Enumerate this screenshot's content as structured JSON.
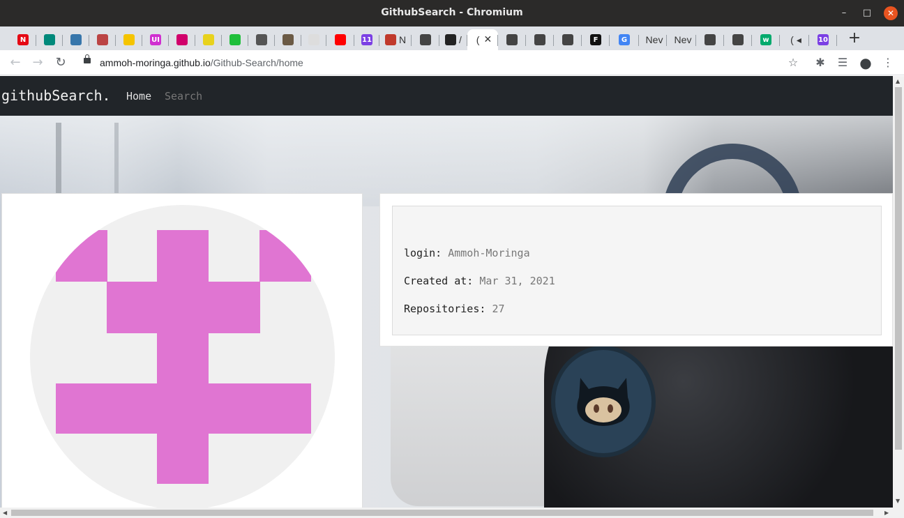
{
  "window": {
    "title": "GithubSearch - Chromium"
  },
  "tabs": [
    {
      "icon": "netflix-icon",
      "color": "#e50914",
      "glyph": "N",
      "label": ""
    },
    {
      "icon": "meet-icon",
      "color": "#00897b",
      "glyph": "",
      "label": ""
    },
    {
      "icon": "python-icon",
      "color": "#3776ab",
      "glyph": "",
      "label": ""
    },
    {
      "icon": "openai-icon",
      "color": "#b44",
      "glyph": "",
      "label": ""
    },
    {
      "icon": "slash-icon",
      "color": "#f5c400",
      "glyph": "",
      "label": ""
    },
    {
      "icon": "ui-icon",
      "color": "#d02fd0",
      "glyph": "UI",
      "label": ""
    },
    {
      "icon": "dribbble-icon",
      "color": "#d1006b",
      "glyph": "",
      "label": ""
    },
    {
      "icon": "yellow-app-icon",
      "color": "#e8d21d",
      "glyph": "",
      "label": ""
    },
    {
      "icon": "green-app-icon",
      "color": "#1fbf3b",
      "glyph": "",
      "label": ""
    },
    {
      "icon": "book-icon",
      "color": "#555",
      "glyph": "",
      "label": ""
    },
    {
      "icon": "photo-icon",
      "color": "#6b5a45",
      "glyph": "",
      "label": ""
    },
    {
      "icon": "box-icon",
      "color": "#ddd",
      "glyph": "",
      "label": ""
    },
    {
      "icon": "youtube-icon",
      "color": "#ff0000",
      "glyph": "",
      "label": ""
    },
    {
      "icon": "calendar-icon",
      "color": "#7b3fe4",
      "glyph": "11",
      "label": ""
    },
    {
      "icon": "record-icon",
      "color": "#c0392b",
      "glyph": "",
      "label": "N"
    },
    {
      "icon": "globe-icon",
      "color": "#444",
      "glyph": "",
      "label": ""
    },
    {
      "icon": "github-icon",
      "color": "#222",
      "glyph": "",
      "label": "/"
    },
    {
      "icon": "active-tab",
      "color": "#fff",
      "glyph": "",
      "label": "("
    },
    {
      "icon": "globe-icon",
      "color": "#444",
      "glyph": "",
      "label": ""
    },
    {
      "icon": "globe-icon",
      "color": "#444",
      "glyph": "",
      "label": ""
    },
    {
      "icon": "globe-icon",
      "color": "#444",
      "glyph": "",
      "label": ""
    },
    {
      "icon": "figma-icon",
      "color": "#111",
      "glyph": "F",
      "label": ""
    },
    {
      "icon": "google-icon",
      "color": "#4285f4",
      "glyph": "G",
      "label": ""
    },
    {
      "icon": "new-tab",
      "color": "#dee1e6",
      "glyph": "",
      "label": "Nev"
    },
    {
      "icon": "new-tab",
      "color": "#dee1e6",
      "glyph": "",
      "label": "Nev"
    },
    {
      "icon": "globe-icon",
      "color": "#444",
      "glyph": "",
      "label": ""
    },
    {
      "icon": "globe-icon",
      "color": "#444",
      "glyph": "",
      "label": ""
    },
    {
      "icon": "w3-icon",
      "color": "#04aa6d",
      "glyph": "w",
      "label": ""
    },
    {
      "icon": "audio-icon",
      "color": "#dee1e6",
      "glyph": "",
      "label": "("
    },
    {
      "icon": "calendar10-icon",
      "color": "#7b3fe4",
      "glyph": "10",
      "label": ""
    }
  ],
  "address": {
    "host": "ammoh-moringa.github.io",
    "path": "/Github-Search/home"
  },
  "site": {
    "brand": "githubSearch.",
    "nav": {
      "home": "Home",
      "search": "Search"
    }
  },
  "profile": {
    "login_label": "login:",
    "login_value": "Ammoh-Moringa",
    "created_label": "Created at:",
    "created_value": "Mar 31, 2021",
    "repos_label": "Repositories:",
    "repos_value": "27"
  },
  "identicon": {
    "color": "#e075d2",
    "background": "#f0f0f0"
  }
}
